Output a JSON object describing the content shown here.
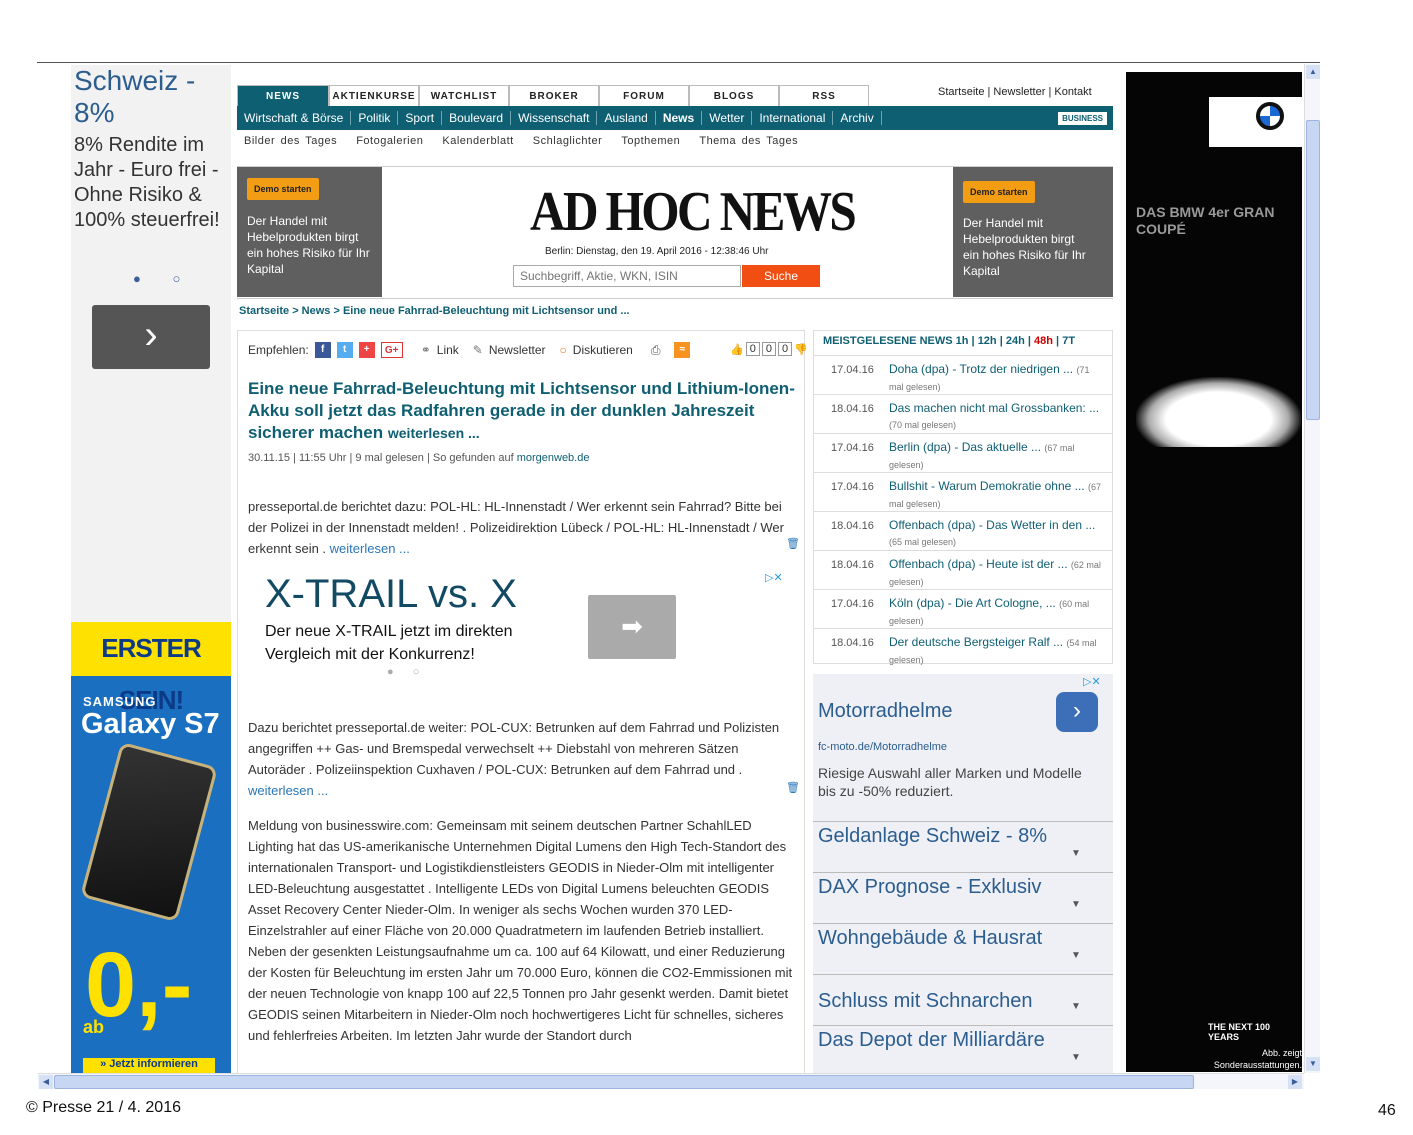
{
  "left_ad": {
    "promo_title": "Schweiz - 8%",
    "promo_text": "8% Rendite im Jahr - Euro frei - Ohne Risiko & 100% steuerfrei!",
    "dots": "● ○",
    "next": "›"
  },
  "galaxy_ad": {
    "banner": "ERSTER SEIN!",
    "brand": "SAMSUNG",
    "model": "Galaxy S7",
    "price": "0,-",
    "currency": "€*",
    "ab": "ab",
    "cta": "» Jetzt informieren"
  },
  "nav": {
    "tabs": [
      "NEWS",
      "AKTIENKURSE",
      "WATCHLIST",
      "BROKER",
      "FORUM",
      "BLOGS",
      "RSS"
    ],
    "top_links": "Startseite | Newsletter | Kontakt",
    "bar": [
      "Wirtschaft & Börse",
      "Politik",
      "Sport",
      "Boulevard",
      "Wissenschaft",
      "Ausland",
      "News",
      "Wetter",
      "International",
      "Archiv"
    ],
    "business": "BUSINESS",
    "sub": [
      "Bilder des Tages",
      "Fotogalerien",
      "Kalenderblatt",
      "Schlaglichter",
      "Topthemen",
      "Thema des Tages"
    ]
  },
  "header": {
    "demo_label": "Demo starten",
    "demo_text": "Der Handel mit Hebelprodukten birgt ein hohes Risiko für Ihr Kapital",
    "logo": "AD HOC NEWS",
    "date": "Berlin: Dienstag, den 19. April 2016 - 12:38:46 Uhr",
    "search_placeholder": "Suchbegriff, Aktie, WKN, ISIN",
    "search_button": "Suche"
  },
  "breadcrumb": "Startseite > News > Eine neue Fahrrad-Beleuchtung mit Lichtsensor und ...",
  "article": {
    "share_label": "Empfehlen:",
    "link": "Link",
    "newsletter": "Newsletter",
    "discuss": "Diskutieren",
    "votes": [
      "0",
      "0",
      "0"
    ],
    "headline": "Eine neue Fahrrad-Beleuchtung mit Lichtsensor und Lithium-Ionen-Akku soll jetzt das Radfahren gerade in der dunklen Jahreszeit sicherer machen",
    "headline_more": "weiterlesen ...",
    "meta": "30.11.15 | 11:55 Uhr | 9 mal gelesen | So gefunden auf",
    "source": "morgenweb.de",
    "p1": "presseportal.de berichtet dazu: POL-HL: HL-Innenstadt / Wer erkennt sein Fahrrad? Bitte bei der Polizei in der Innenstadt melden! . Polizeidirektion Lübeck / POL-HL: HL-Innenstadt / Wer erkennt sein .",
    "p2": "Dazu berichtet presseportal.de weiter: POL-CUX: Betrunken auf dem Fahrrad und Polizisten angegriffen ++ Gas- und Bremspedal verwechselt ++ Diebstahl von mehreren Sätzen Autoräder . Polizeiinspektion Cuxhaven / POL-CUX: Betrunken auf dem Fahrrad und .",
    "p3": "Meldung von businesswire.com: Gemeinsam mit seinem deutschen Partner SchahlLED Lighting hat das US-amerikanische Unternehmen Digital Lumens den High Tech-Standort des internationalen Transport- und Logistikdienstleisters GEODIS in Nieder-Olm mit intelligenter LED-Beleuchtung ausgestattet . Intelligente LEDs von Digital Lumens beleuchten GEODIS Asset Recovery Center Nieder-Olm. In weniger als sechs Wochen wurden 370 LED-Einzelstrahler auf einer Fläche von 20.000 Quadratmetern im laufenden Betrieb installiert. Neben der gesenkten Leistungsaufnahme um ca. 100 auf 64 Kilowatt, und einer Reduzierung der Kosten für Beleuchtung im ersten Jahr um 70.000 Euro, können die CO2-Emmissionen mit der neuen Technologie von knapp 100 auf 22,5 Tonnen pro Jahr gesenkt werden. Damit bietet GEODIS seinen Mitarbeitern in Nieder-Olm noch hochwertigeres Licht für schnelles, sicheres und fehlerfreies Arbeiten. Im letzten Jahr wurde der Standort durch",
    "weiterlesen": "weiterlesen ..."
  },
  "xtrail_ad": {
    "title": "X-TRAIL vs. X",
    "text": "Der neue X-TRAIL jetzt im direkten Vergleich mit der Konkurrenz!",
    "arrow": "➡",
    "adchoice": "▷✕",
    "dots": "● ○"
  },
  "meistgelesen": {
    "title": "MEISTGELESENE NEWS",
    "periods": [
      "1h",
      "12h",
      "24h",
      "48h",
      "7T"
    ],
    "rows": [
      {
        "date": "17.04.16",
        "title": "Doha (dpa) - Trotz der niedrigen ...",
        "reads": "(71 mal gelesen)"
      },
      {
        "date": "18.04.16",
        "title": "Das machen nicht mal Grossbanken: ...",
        "reads": "(70 mal gelesen)"
      },
      {
        "date": "17.04.16",
        "title": "Berlin (dpa) - Das aktuelle ...",
        "reads": "(67 mal gelesen)"
      },
      {
        "date": "17.04.16",
        "title": "Bullshit - Warum Demokratie ohne ...",
        "reads": "(67 mal gelesen)"
      },
      {
        "date": "18.04.16",
        "title": "Offenbach (dpa) - Das Wetter in den ...",
        "reads": "(65 mal gelesen)"
      },
      {
        "date": "18.04.16",
        "title": "Offenbach (dpa) - Heute ist der ...",
        "reads": "(62 mal gelesen)"
      },
      {
        "date": "17.04.16",
        "title": "Köln (dpa) - Die Art Cologne, ...",
        "reads": "(60 mal gelesen)"
      },
      {
        "date": "18.04.16",
        "title": "Der deutsche Bergsteiger Ralf ...",
        "reads": "(54 mal gelesen)"
      }
    ]
  },
  "right_ad": {
    "title": "Motorradhelme",
    "url": "fc-moto.de/Motorradhelme",
    "desc": "Riesige Auswahl aller Marken und Modelle bis zu -50% reduziert.",
    "arrow": "›",
    "adchoice": "▷✕",
    "items": [
      "Geldanlage Schweiz - 8%",
      "DAX Prognose - Exklusiv",
      "Wohngebäude & Hausrat",
      "Schluss mit Schnarchen",
      "Das Depot der Milliardäre"
    ],
    "caret": "▼"
  },
  "bmw_ad": {
    "title": "DAS BMW 4er GRAN COUPÉ",
    "hundred": "THE NEXT 100 YEARS",
    "note": "Abb. zeigt Sonderausstattungen."
  },
  "footer": "© Presse 21 / 4. 2016",
  "page_number": "46"
}
